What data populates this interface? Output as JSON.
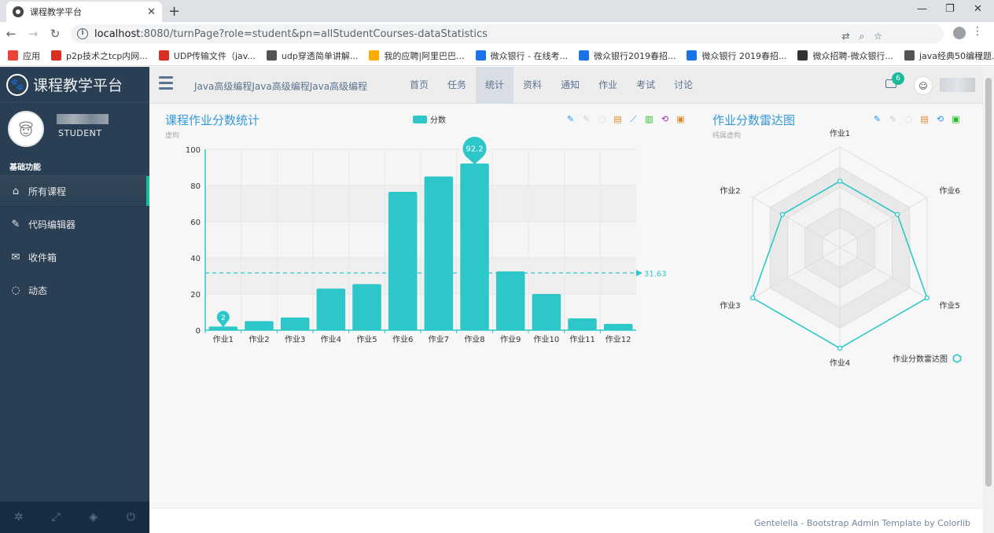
{
  "browser": {
    "tab_title": "课程教学平台",
    "url_host": "localhost",
    "url_rest": ":8080/turnPage?role=student&pn=allStudentCourses-dataStatistics",
    "bookmarks": [
      {
        "label": "应用",
        "color": "#ea4335"
      },
      {
        "label": "p2p技术之tcp内网...",
        "color": "#d93025"
      },
      {
        "label": "UDP传输文件（jav...",
        "color": "#d93025"
      },
      {
        "label": "udp穿透简单讲解...",
        "color": "#555555"
      },
      {
        "label": "我的应聘|阿里巴巴...",
        "color": "#f9ab00"
      },
      {
        "label": "微众银行 - 在线考...",
        "color": "#1a73e8"
      },
      {
        "label": "微众银行2019春招...",
        "color": "#1a73e8"
      },
      {
        "label": "微众银行 2019春招...",
        "color": "#1a73e8"
      },
      {
        "label": "微众招聘-微众银行...",
        "color": "#333333"
      },
      {
        "label": "java经典50编程题...",
        "color": "#555555"
      }
    ]
  },
  "sidebar": {
    "brand": "课程教学平台",
    "role": "STUDENT",
    "section_title": "基础功能",
    "items": [
      {
        "label": "所有课程",
        "icon": "home-icon",
        "glyph": "⌂"
      },
      {
        "label": "代码编辑器",
        "icon": "edit-icon",
        "glyph": "✎"
      },
      {
        "label": "收件箱",
        "icon": "envelope-icon",
        "glyph": "✉"
      },
      {
        "label": "动态",
        "icon": "comment-icon",
        "glyph": "◌"
      }
    ]
  },
  "topnav": {
    "course_name": "Java高级编程Java高级编程Java高级编程",
    "tabs": [
      "首页",
      "任务",
      "统计",
      "资料",
      "通知",
      "作业",
      "考试",
      "讨论"
    ],
    "active_tab": "统计",
    "mail_badge": "6"
  },
  "bar_panel": {
    "title": "课程作业分数统计",
    "subtitle": "虚构",
    "legend": "分数",
    "max_label": "92.2",
    "min_label": "2",
    "avg_label": "31.63"
  },
  "radar_panel": {
    "title": "作业分数雷达图",
    "subtitle": "纯属虚构",
    "legend": "作业分数雷达图"
  },
  "chart_data": [
    {
      "type": "bar",
      "title": "课程作业分数统计",
      "subtitle": "虚构",
      "categories": [
        "作业1",
        "作业2",
        "作业3",
        "作业4",
        "作业5",
        "作业6",
        "作业7",
        "作业8",
        "作业9",
        "作业10",
        "作业11",
        "作业12"
      ],
      "series": [
        {
          "name": "分数",
          "values": [
            2,
            5,
            7,
            23,
            25.5,
            76.5,
            85,
            92.2,
            32.5,
            20,
            6.5,
            3.5
          ]
        }
      ],
      "ylim": [
        0,
        100
      ],
      "yticks": [
        0,
        20,
        40,
        60,
        80,
        100
      ],
      "markline_average": 31.63,
      "markpoint_max": 92.2,
      "markpoint_min": 2,
      "color": "#2ec7c9"
    },
    {
      "type": "radar",
      "title": "作业分数雷达图",
      "subtitle": "纯属虚构",
      "indicators": [
        "作业1",
        "作业6",
        "作业5",
        "作业4",
        "作业3",
        "作业2"
      ],
      "series": [
        {
          "name": "作业分数雷达图",
          "values": [
            0.66,
            0.66,
            1.0,
            1.0,
            1.0,
            0.66
          ]
        }
      ],
      "color": "#2ec7c9"
    }
  ],
  "footer": "Gentelella - Bootstrap Admin Template by Colorlib"
}
